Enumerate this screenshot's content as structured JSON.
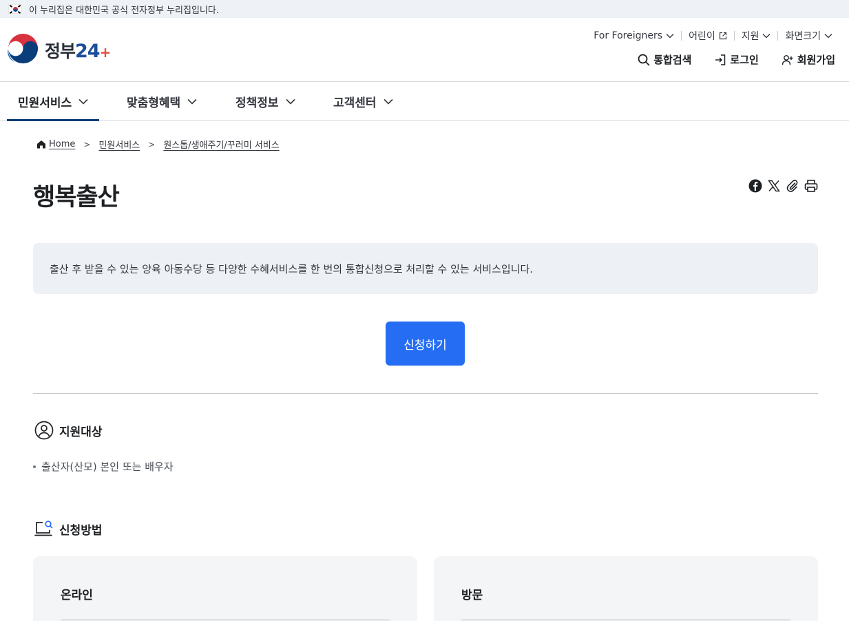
{
  "gov_banner": {
    "text": "이 누리집은 대한민국 공식 전자정부 누리집입니다."
  },
  "logo": {
    "text_main": "정부",
    "text_num": "24",
    "text_plus": "+"
  },
  "util_menu": {
    "foreigners": "For Foreigners",
    "kids": "어린이",
    "support": "지원",
    "font_size": "화면크기"
  },
  "top_actions": {
    "search": "통합검색",
    "login": "로그인",
    "signup": "회원가입"
  },
  "gnb": {
    "items": [
      {
        "label": "민원서비스"
      },
      {
        "label": "맞춤형혜택"
      },
      {
        "label": "정책정보"
      },
      {
        "label": "고객센터"
      }
    ]
  },
  "breadcrumb": {
    "home": "Home",
    "level1": "민원서비스",
    "level2": "원스톱/생애주기/꾸러미 서비스",
    "separator": ">"
  },
  "page": {
    "title": "행복출산",
    "intro": "출산 후 받을 수 있는 양육 아동수당 등 다양한 수혜서비스를 한 번의 통합신청으로 처리할 수 있는 서비스입니다.",
    "apply_button": "신청하기"
  },
  "share_tools": [
    "facebook-icon",
    "x-icon",
    "link-icon",
    "print-icon"
  ],
  "sections": {
    "target": {
      "title": "지원대상",
      "items": [
        "출산자(산모) 본인 또는 배우자"
      ]
    },
    "method": {
      "title": "신청방법",
      "cards": [
        {
          "title": "온라인"
        },
        {
          "title": "방문"
        }
      ]
    }
  },
  "colors": {
    "primary": "#256ef4",
    "nav_active": "#0b3d7a",
    "intro_bg": "#edf0f4",
    "banner_bg": "#eef1f6"
  }
}
